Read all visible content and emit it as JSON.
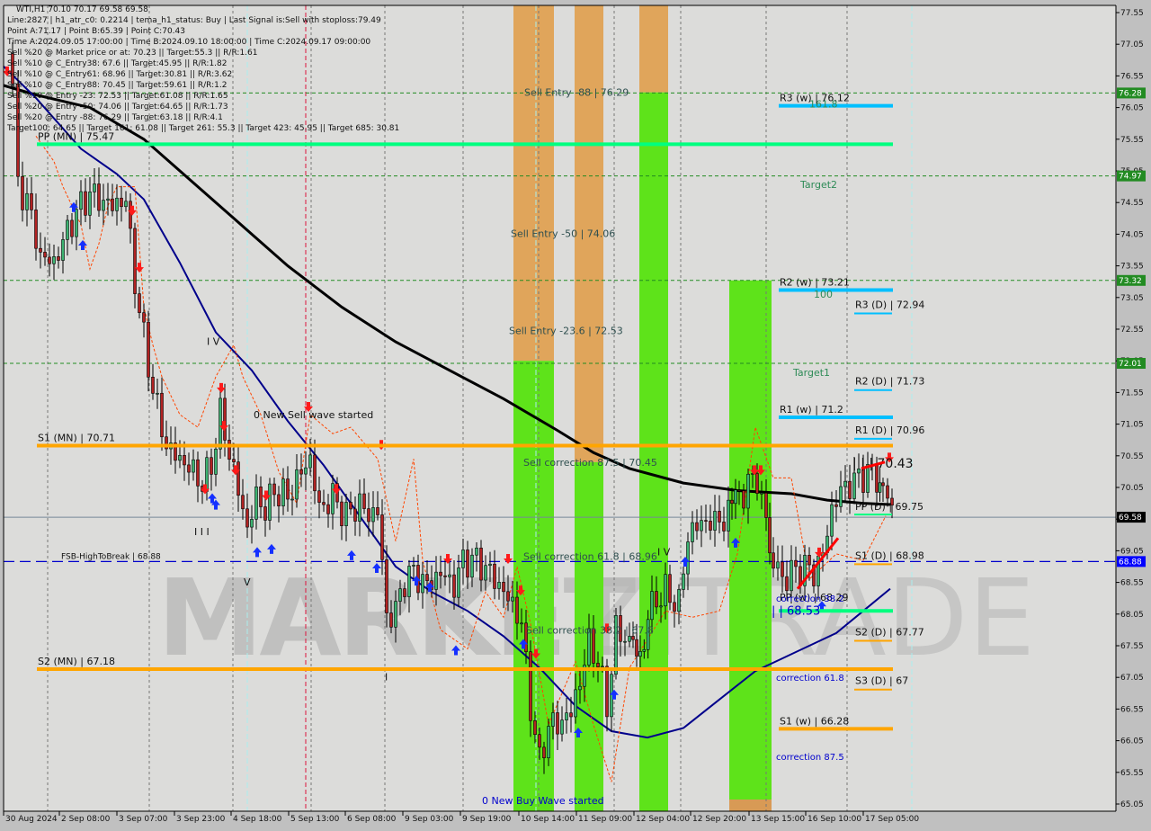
{
  "chart_data": {
    "type": "candlestick",
    "symbol": "WTI",
    "timeframe": "H1",
    "ohlc_header": "WTI,H1  70.10 70.17 69.58 69.58",
    "ylim": [
      65.05,
      77.55
    ],
    "y_ticks": [
      "77.55",
      "77.05",
      "76.55",
      "76.05",
      "75.55",
      "75.05",
      "74.55",
      "74.05",
      "73.55",
      "73.05",
      "72.55",
      "72.05",
      "71.55",
      "71.05",
      "70.55",
      "70.05",
      "69.55",
      "69.05",
      "68.55",
      "68.05",
      "67.55",
      "67.05",
      "66.55",
      "66.05",
      "65.55",
      "65.05"
    ],
    "x_ticks": [
      "30 Aug 2024",
      "2 Sep 08:00",
      "3 Sep 07:00",
      "3 Sep 23:00",
      "4 Sep 18:00",
      "5 Sep 13:00",
      "6 Sep 08:00",
      "9 Sep 03:00",
      "9 Sep 19:00",
      "10 Sep 14:00",
      "11 Sep 09:00",
      "12 Sep 04:00",
      "12 Sep 20:00",
      "13 Sep 15:00",
      "16 Sep 10:00",
      "17 Sep 05:00"
    ],
    "current_price": {
      "value": 69.58,
      "label": "69.58"
    },
    "price_tags": [
      {
        "value": 76.28,
        "label": "76.28",
        "color": "#228b22"
      },
      {
        "value": 74.97,
        "label": "74.97",
        "color": "#228b22"
      },
      {
        "value": 73.32,
        "label": "73.32",
        "color": "#228b22"
      },
      {
        "value": 72.01,
        "label": "72.01",
        "color": "#228b22"
      },
      {
        "value": 68.88,
        "label": "68.88",
        "color": "#0000ff"
      }
    ],
    "info_lines": [
      "Line:2827 | h1_atr_c0: 0.2214 | tema_h1_status: Buy | Last Signal is:Sell with stoploss:79.49",
      "Point A:71.17 | Point B:65.39 | Point C:70.43",
      "Time A:2024.09.05 17:00:00 | Time B:2024.09.10 18:00:00 | Time C:2024.09.17 09:00:00",
      "Sell %20 @ Market price or at: 70.23 || Target:55.3 || R/R:1.61",
      "Sell %10 @ C_Entry38: 67.6 || Target:45.95 || R/R:1.82",
      "Sell %10 @ C_Entry61: 68.96 || Target:30.81 || R/R:3.62",
      "Sell %10 @ C_Entry88: 70.45 || Target:59.61 || R/R:1.2",
      "Sell %10 @ Entry -23: 72.53 || Target:61.08 || R/R:1.65",
      "Sell %20 @ Entry -50: 74.06 || Target:64.65 || R/R:1.73",
      "Sell %20 @ Entry -88: 76.29 || Target:63.18 || R/R:4.1",
      "Target100: 64.65 || Target 161: 61.08 || Target 261: 55.3 || Target 423: 45.95 || Target 685: 30.81"
    ],
    "levels": [
      {
        "name": "PP (MN)",
        "value": 75.47,
        "label": "PP (MN) | 75.47",
        "color": "#00ff7f",
        "span": "monthly"
      },
      {
        "name": "S1 (MN)",
        "value": 70.71,
        "label": "S1 (MN) | 70.71",
        "color": "#ffa500",
        "span": "monthly"
      },
      {
        "name": "S2 (MN)",
        "value": 67.18,
        "label": "S2 (MN) | 67.18",
        "color": "#ffa500",
        "span": "monthly"
      },
      {
        "name": "R3 (w)",
        "value": 76.12,
        "label": "R3 (w) | 76.12",
        "color": "#00bfff",
        "span": "weekly"
      },
      {
        "name": "R2 (w)",
        "value": 73.21,
        "label": "R2 (w) | 73.21",
        "color": "#00bfff",
        "span": "weekly"
      },
      {
        "name": "R1 (w)",
        "value": 71.2,
        "label": "R1 (w) | 71.2",
        "color": "#00bfff",
        "span": "weekly"
      },
      {
        "name": "PP (w)",
        "value": 68.29,
        "label": "PP (w) | 68.29",
        "color": "#00ff7f",
        "span": "weekly"
      },
      {
        "name": "S1 (w)",
        "value": 66.28,
        "label": "S1 (w) | 66.28",
        "color": "#ffa500",
        "span": "weekly"
      },
      {
        "name": "R3 (D)",
        "value": 72.94,
        "label": "R3 (D) | 72.94",
        "color": "#00bfff",
        "span": "daily"
      },
      {
        "name": "R2 (D)",
        "value": 71.73,
        "label": "R2 (D) | 71.73",
        "color": "#00bfff",
        "span": "daily"
      },
      {
        "name": "R1 (D)",
        "value": 70.96,
        "label": "R1 (D) | 70.96",
        "color": "#00bfff",
        "span": "daily"
      },
      {
        "name": "PP (D)",
        "value": 69.75,
        "label": "PP (D) | 69.75",
        "color": "#00ff7f",
        "span": "daily"
      },
      {
        "name": "S1 (D)",
        "value": 68.98,
        "label": "S1 (D) | 68.98",
        "color": "#ffa500",
        "span": "daily"
      },
      {
        "name": "S2 (D)",
        "value": 67.77,
        "label": "S2 (D) | 67.77",
        "color": "#ffa500",
        "span": "daily"
      },
      {
        "name": "S3 (D)",
        "value": 67.0,
        "label": "S3 (D) | 67",
        "color": "#ffa500",
        "span": "daily"
      }
    ],
    "fsb_line": {
      "value": 68.88,
      "label": "FSB-HighToBreak | 68.88"
    },
    "target_lines": [
      {
        "value": 76.28,
        "label": "161.8"
      },
      {
        "value": 74.97,
        "label": "Target2"
      },
      {
        "value": 73.32,
        "label": "100"
      },
      {
        "value": 72.01,
        "label": "Target1"
      }
    ],
    "zone_labels": [
      {
        "value": 76.29,
        "label": "Sell Entry -88 | 76.29"
      },
      {
        "value": 74.06,
        "label": "Sell Entry -50 | 74.06"
      },
      {
        "value": 72.53,
        "label": "Sell Entry -23.6 | 72.53"
      },
      {
        "value": 70.45,
        "label": "Sell correction 87.5 | 70.45"
      },
      {
        "value": 68.96,
        "label": "Sell correction 61.8 | 68.96"
      },
      {
        "value": 67.8,
        "label": "Sell correction 38.2 | 67.8"
      }
    ],
    "correction_labels": [
      {
        "value": 68.3,
        "label": "correction 38.2"
      },
      {
        "value": 67.05,
        "label": "correction 61.8"
      },
      {
        "value": 65.8,
        "label": "correction 87.5"
      }
    ],
    "annotations": [
      {
        "label": "0 New Sell wave started",
        "value": 71.2
      },
      {
        "label": "0 New Buy Wave started",
        "value": 65.05
      },
      {
        "label": "| | | 70.43",
        "value": 70.43
      },
      {
        "label": "| | 68.53",
        "value": 68.1
      }
    ],
    "watermark": "MARKETZITRADE",
    "colors": {
      "bull": "#3cb371",
      "bear": "#b22222",
      "ema_slow": "#000000",
      "ema_fast": "#00008b",
      "orange_zone": "#e0a050",
      "green_zone": "#5ee31a",
      "background": "#dcdcda"
    }
  }
}
